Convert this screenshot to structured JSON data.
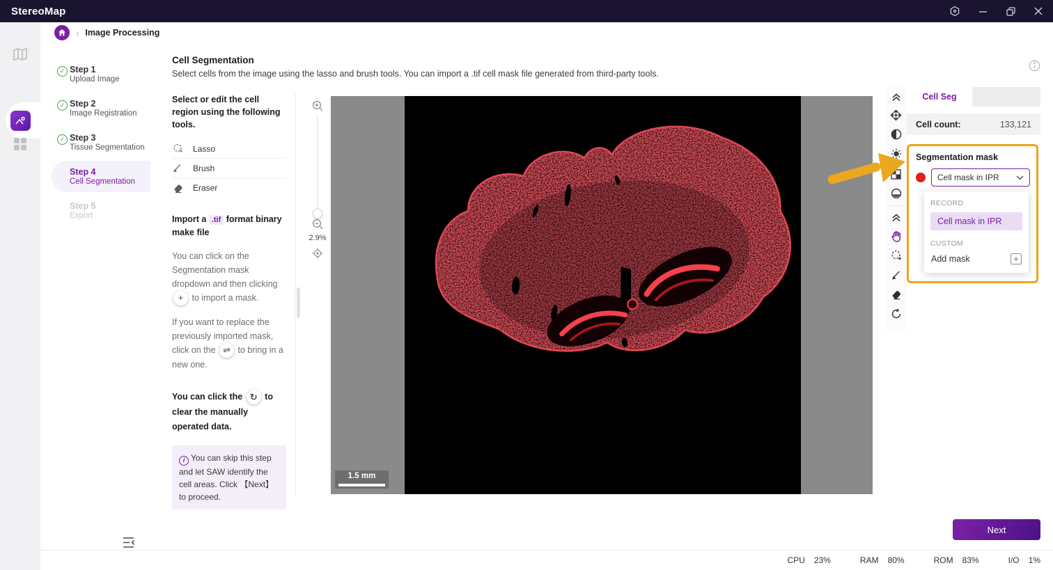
{
  "titlebar": {
    "app": "StereoMap"
  },
  "breadcrumb": {
    "label": "Image Processing"
  },
  "header": {
    "title": "Cell Segmentation",
    "subtitle": "Select cells from the image using the lasso and brush tools. You can import a .tif cell mask file generated from third-party tools."
  },
  "steps": [
    {
      "number": "Step 1",
      "name": "Upload Image",
      "state": "done"
    },
    {
      "number": "Step 2",
      "name": "Image Registration",
      "state": "done"
    },
    {
      "number": "Step 3",
      "name": "Tissue Segmentation",
      "state": "done"
    },
    {
      "number": "Step 4",
      "name": "Cell Segmentation",
      "state": "active"
    },
    {
      "number": "Step 5",
      "name": "Export",
      "state": "disabled"
    }
  ],
  "tools": {
    "select_title": "Select or edit the cell region using the following tools.",
    "items": [
      {
        "label": "Lasso"
      },
      {
        "label": "Brush"
      },
      {
        "label": "Eraser"
      }
    ],
    "import_title_1": "Import a",
    "import_title_tif": ".tif",
    "import_title_2": "format binary make file",
    "import_hint_1": "You can click on the Segmentation mask dropdown and then clicking",
    "import_hint_2": "to import a mask.",
    "replace_hint_1": "If you want to replace the previously imported mask, click on the",
    "replace_hint_2": "to bring in a new one.",
    "clear_hint_1": "You can click the",
    "clear_hint_2": "to clear the manually operated data.",
    "info_note": "You can skip this step and let SAW identify the cell areas. Click 【Next】 to proceed."
  },
  "zoom_control": {
    "level": "2.9%"
  },
  "canvas": {
    "scale_bar": "1.5 mm"
  },
  "panel": {
    "tab": "Cell Seg",
    "cell_count_label": "Cell count:",
    "cell_count_value": "133,121",
    "mask_section": {
      "title": "Segmentation mask",
      "selected": "Cell mask in IPR",
      "record_label": "RECORD",
      "record_item": "Cell mask in IPR",
      "custom_label": "CUSTOM",
      "add_mask": "Add mask"
    }
  },
  "footer": {
    "next_label": "Next",
    "stats": [
      {
        "label": "CPU",
        "value": "23%"
      },
      {
        "label": "RAM",
        "value": "80%"
      },
      {
        "label": "ROM",
        "value": "83%"
      },
      {
        "label": "I/O",
        "value": "1%"
      }
    ]
  },
  "colors": {
    "accent_purple": "#7b1fa2",
    "highlight_orange": "#f0a31a",
    "mask_red": "#e41d1d",
    "step_done_green": "#43a047",
    "titlebar_bg": "#1a1430",
    "canvas_gray": "#8a8a8a",
    "next_gradient_start": "#7d22a8",
    "next_gradient_end": "#4b1186"
  }
}
